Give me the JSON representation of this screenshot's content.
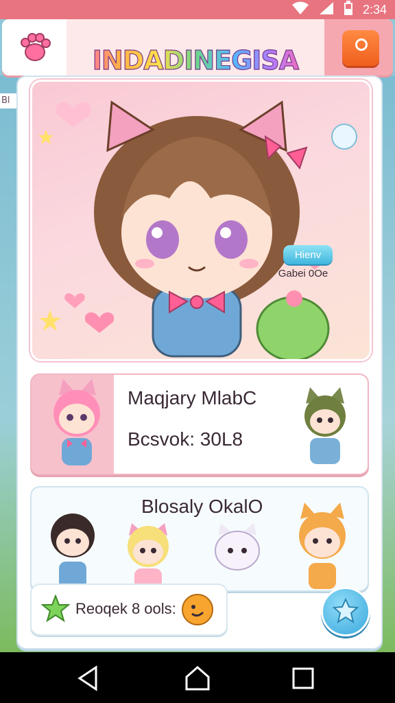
{
  "status_bar": {
    "time": "2:34",
    "icons": [
      "wifi-icon",
      "signal-icon",
      "battery-icon"
    ]
  },
  "header": {
    "title": "INDADINEGISA",
    "left_icon": "paw-icon",
    "right_icon": "settings-icon"
  },
  "side": {
    "left_tab": "Bl"
  },
  "hero": {
    "button_label": "Hienv",
    "caption": "Gabei 0Oe"
  },
  "character_card": {
    "name": "Maqjary MlabC",
    "stat": "Bcsvok: 30L8"
  },
  "group_card": {
    "title": "Blosaly OkalO"
  },
  "reward": {
    "label": "Reoqek 8 ools:",
    "icon": "star-icon",
    "badge_icon": "coin-face-icon"
  },
  "fab": {
    "icon": "star-badge-icon"
  },
  "nav": {
    "items": [
      "back-icon",
      "home-icon",
      "recents-icon"
    ]
  },
  "colors": {
    "status_bar": "#e8747f",
    "header_bg": "#fde9ea",
    "accent_orange": "#ef5f1e",
    "accent_blue": "#3fb6de",
    "card_pink": "#f7c1cc"
  }
}
